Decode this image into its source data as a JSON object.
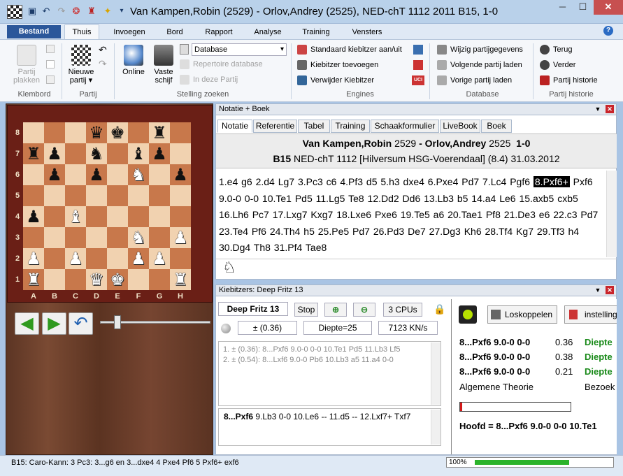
{
  "window": {
    "title": "Van Kampen,Robin (2529) - Orlov,Andrey (2525), NED-chT 1112 2011  B15, 1-0",
    "controls": {
      "minimize": "─",
      "maximize": "☐",
      "close": "✕"
    }
  },
  "ribbon": {
    "tabs": [
      "Bestand",
      "Thuis",
      "Invoegen",
      "Bord",
      "Rapport",
      "Analyse",
      "Training",
      "Vensters"
    ],
    "active_tab": "Thuis",
    "help": "?",
    "groups": {
      "klembord": {
        "label": "Klembord",
        "paste": "Partij plakken"
      },
      "partij": {
        "label": "Partij",
        "new_game": "Nieuwe partij ▾"
      },
      "stelling": {
        "label": "Stelling zoeken",
        "online": "Online",
        "vaste_schijf": "Vaste schijf",
        "database_select": "Database",
        "repertoire": "Repertoire database",
        "in_deze_partij": "In deze Partij"
      },
      "engines": {
        "label": "Engines",
        "standaard": "Standaard kiebitzer aan/uit",
        "toevoegen": "Kiebitzer toevoegen",
        "verwijder": "Verwijder Kiebitzer"
      },
      "database": {
        "label": "Database",
        "wijzig": "Wijzig partijgegevens",
        "volgende": "Volgende partij laden",
        "vorige": "Vorige partij laden"
      },
      "historie": {
        "label": "Partij historie",
        "terug": "Terug",
        "verder": "Verder",
        "partij_historie": "Partij historie"
      }
    }
  },
  "board": {
    "ranks": [
      "8",
      "7",
      "6",
      "5",
      "4",
      "3",
      "2",
      "1"
    ],
    "files": [
      "A",
      "B",
      "C",
      "D",
      "E",
      "F",
      "G",
      "H"
    ],
    "position": [
      [
        "",
        "",
        "",
        "q",
        "k",
        "",
        "r",
        ""
      ],
      [
        "r",
        "p",
        "",
        "n",
        "",
        "b",
        "p",
        ""
      ],
      [
        "",
        "p",
        "",
        "p",
        "",
        "N",
        "",
        "p"
      ],
      [
        "",
        "",
        "",
        "",
        "",
        "",
        "",
        ""
      ],
      [
        "p",
        "",
        "B",
        "",
        "",
        "",
        "",
        ""
      ],
      [
        "",
        "",
        "",
        "",
        "",
        "N",
        "",
        "P"
      ],
      [
        "P",
        "",
        "P",
        "",
        "",
        "P",
        "P",
        ""
      ],
      [
        "R",
        "",
        "",
        "Q",
        "K",
        "",
        "",
        "R"
      ]
    ],
    "nav": {
      "back": "◀",
      "forward": "▶",
      "undo": "↶"
    }
  },
  "notation": {
    "panel_title": "Notatie + Boek",
    "tabs": [
      "Notatie",
      "Referentie",
      "Tabel",
      "Training",
      "Schaakformulier",
      "LiveBook",
      "Boek"
    ],
    "active_tab": "Notatie",
    "white": "Van Kampen,Robin",
    "white_elo": "2529",
    "black": "Orlov,Andrey",
    "black_elo": "2525",
    "result": "1-0",
    "eco": "B15",
    "event": "NED-chT 1112 [Hilversum HSG-Voerendaal] (8.4) 31.03.2012",
    "moves_before": "1.e4 g6 2.d4 Lg7 3.Pc3 c6 4.Pf3 d5 5.h3 dxe4 6.Pxe4 Pd7 7.Lc4 Pgf6",
    "current_move": "8.Pxf6+",
    "moves_after": "Pxf6 9.0-0 0-0 10.Te1 Pd5 11.Lg5 Te8 12.Dd2 Dd6 13.Lb3 b5 14.a4 Le6 15.axb5 cxb5 16.Lh6 Pc7 17.Lxg7 Kxg7 18.Lxe6 Pxe6 19.Te5 a6 20.Tae1 Pf8 21.De3 e6 22.c3 Pd7 23.Te4 Pf6 24.Th4 h5 25.Pe5 Pd7 26.Pd3 De7 27.Dg3 Kh6 28.Tf4 Kg7 29.Tf3 h4 30.Dg4 Th8 31.Pf4 Tae8",
    "piece_glyph": "♘"
  },
  "kibitzer": {
    "panel_title": "Kiebitzers: Deep Fritz 13",
    "engine": "Deep Fritz 13",
    "stop": "Stop",
    "cpus": "3 CPUs",
    "eval": "±  (0.36)",
    "depth": "Diepte=25",
    "speed": "7123 KN/s",
    "lines": [
      "1. ± (0.36): 8...Pxf6 9.0-0 0-0 10.Te1 Pd5 11.Lb3 Lf5",
      "2. ± (0.54): 8...Lxf6 9.0-0 Pb6 10.Lb3 a5 11.a4 0-0"
    ],
    "best_line_bold": "8...Pxf6",
    "best_line_rest": " 9.Lb3 0-0 10.Le6 -- 11.d5 -- 12.Lxf7+ Txf7",
    "right": {
      "disconnect": "Loskoppelen",
      "settings": "instelling",
      "rows": [
        {
          "move": "8...Pxf6 9.0-0 0-0",
          "score": "0.36",
          "depth": "Diepte"
        },
        {
          "move": "8...Pxf6 9.0-0 0-0",
          "score": "0.38",
          "depth": "Diepte"
        },
        {
          "move": "8...Pxf6 9.0-0 0-0",
          "score": "0.21",
          "depth": "Diepte"
        }
      ],
      "theory": "Algemene Theorie",
      "bezoek": "Bezoek",
      "progress": 0.02,
      "main_line": "Hoofd = 8...Pxf6 9.0-0 0-0 10.Te1"
    }
  },
  "status": {
    "opening": "B15: Caro-Kann: 3 Pc3: 3...g6 en 3...dxe4 4 Pxe4 Pf6 5 Pxf6+ exf6",
    "zoom": "100%",
    "progress": 0.75
  },
  "colors": {
    "accent": "#2b579a",
    "board_light": "#f1d2b0",
    "board_dark": "#c8784b",
    "engine_green": "#1a8a1a"
  }
}
